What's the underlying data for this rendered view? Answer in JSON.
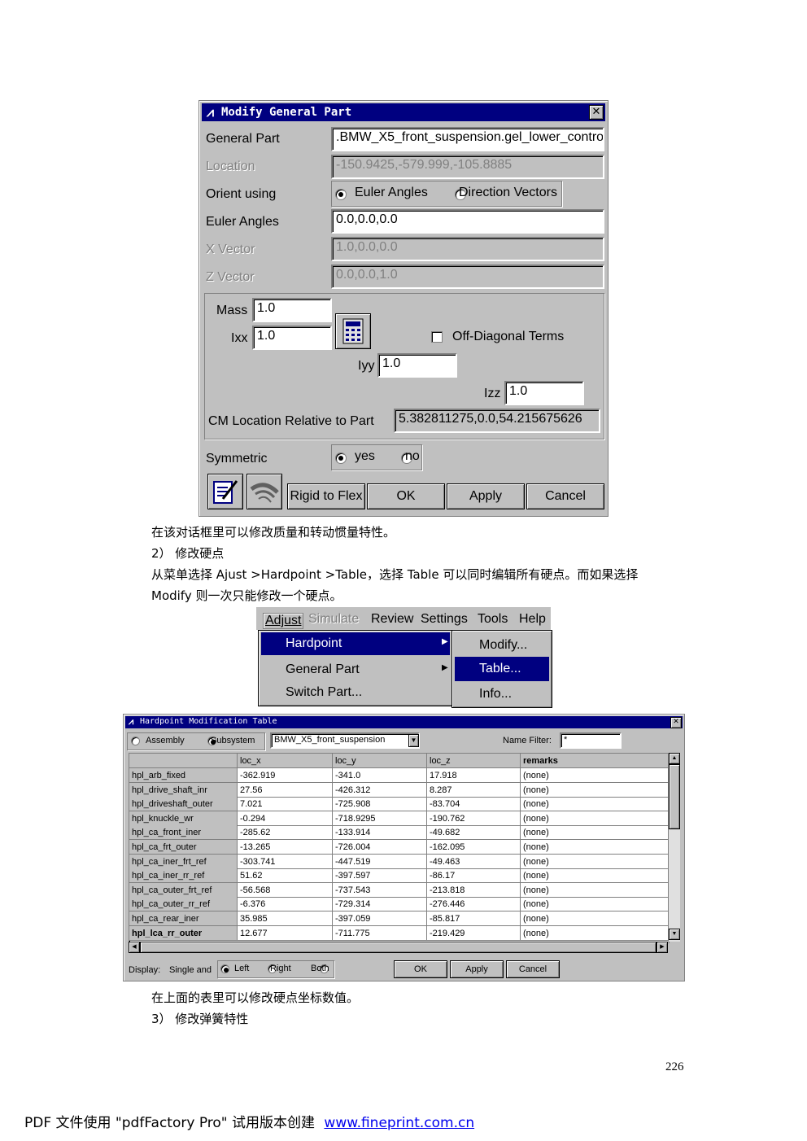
{
  "dialog1": {
    "title": "Modify General Part",
    "general_part_label": "General Part",
    "general_part_value": ".BMW_X5_front_suspension.gel_lower_contro",
    "location_label": "Location",
    "location_value": "-150.9425,-579.999,-105.8885",
    "orient_label": "Orient using",
    "orient_opt1": "Euler Angles",
    "orient_opt2": "Direction Vectors",
    "euler_label": "Euler Angles",
    "euler_value": "0.0,0.0,0.0",
    "xvec_label": "X Vector",
    "xvec_value": "1.0,0.0,0.0",
    "zvec_label": "Z Vector",
    "zvec_value": "0.0,0.0,1.0",
    "mass_label": "Mass",
    "mass_value": "1.0",
    "ixx_label": "Ixx",
    "ixx_value": "1.0",
    "offdiag_label": "Off-Diagonal Terms",
    "iyy_label": "Iyy",
    "iyy_value": "1.0",
    "izz_label": "Izz",
    "izz_value": "1.0",
    "cm_label": "CM Location Relative to Part",
    "cm_value": "5.382811275,0.0,54.215675626",
    "sym_label": "Symmetric",
    "sym_yes": "yes",
    "sym_no": "no",
    "btn_rigid": "Rigid to Flex",
    "btn_ok": "OK",
    "btn_apply": "Apply",
    "btn_cancel": "Cancel"
  },
  "text1": "在该对话框里可以修改质量和转动惯量特性。",
  "text2": "2） 修改硬点",
  "text3": "从菜单选择 Ajust >Hardpoint >Table，选择 Table 可以同时编辑所有硬点。而如果选择",
  "text4": "Modify 则一次只能修改一个硬点。",
  "menu": {
    "bar": [
      "Adjust",
      "Simulate",
      "Review",
      "Settings",
      "Tools",
      "Help"
    ],
    "main_items": [
      "Hardpoint",
      "General Part",
      "Switch Part..."
    ],
    "sub_items": [
      "Modify...",
      "Table...",
      "Info..."
    ]
  },
  "hp_table": {
    "title": "Hardpoint Modification Table",
    "assembly": "Assembly",
    "subsystem": "Subsystem",
    "subsystem_value": "BMW_X5_front_suspension",
    "name_filter_label": "Name Filter:",
    "name_filter_value": "*",
    "columns": [
      "loc_x",
      "loc_y",
      "loc_z",
      "remarks"
    ],
    "rows": [
      [
        "hpl_arb_fixed",
        "-362.919",
        "-341.0",
        "17.918",
        "(none)"
      ],
      [
        "hpl_drive_shaft_inr",
        "27.56",
        "-426.312",
        "8.287",
        "(none)"
      ],
      [
        "hpl_driveshaft_outer",
        "7.021",
        "-725.908",
        "-83.704",
        "(none)"
      ],
      [
        "hpl_knuckle_wr",
        "-0.294",
        "-718.9295",
        "-190.762",
        "(none)"
      ],
      [
        "hpl_ca_front_iner",
        "-285.62",
        "-133.914",
        "-49.682",
        "(none)"
      ],
      [
        "hpl_ca_frt_outer",
        "-13.265",
        "-726.004",
        "-162.095",
        "(none)"
      ],
      [
        "hpl_ca_iner_frt_ref",
        "-303.741",
        "-447.519",
        "-49.463",
        "(none)"
      ],
      [
        "hpl_ca_iner_rr_ref",
        "51.62",
        "-397.597",
        "-86.17",
        "(none)"
      ],
      [
        "hpl_ca_outer_frt_ref",
        "-56.568",
        "-737.543",
        "-213.818",
        "(none)"
      ],
      [
        "hpl_ca_outer_rr_ref",
        "-6.376",
        "-729.314",
        "-276.446",
        "(none)"
      ],
      [
        "hpl_ca_rear_iner",
        "35.985",
        "-397.059",
        "-85.817",
        "(none)"
      ],
      [
        "hpl_lca_rr_outer",
        "12.677",
        "-711.775",
        "-219.429",
        "(none)"
      ]
    ],
    "display_label": "Display:",
    "single_label": "Single and",
    "left": "Left",
    "right": "Right",
    "both": "Both",
    "ok": "OK",
    "apply": "Apply",
    "cancel": "Cancel"
  },
  "text5": "在上面的表里可以修改硬点坐标数值。",
  "text6": "3） 修改弹簧特性",
  "page_number": "226",
  "footer": {
    "prefix": "PDF 文件使用 \"pdfFactory Pro\" 试用版本创建",
    "link": "www.fineprint.com.cn"
  }
}
